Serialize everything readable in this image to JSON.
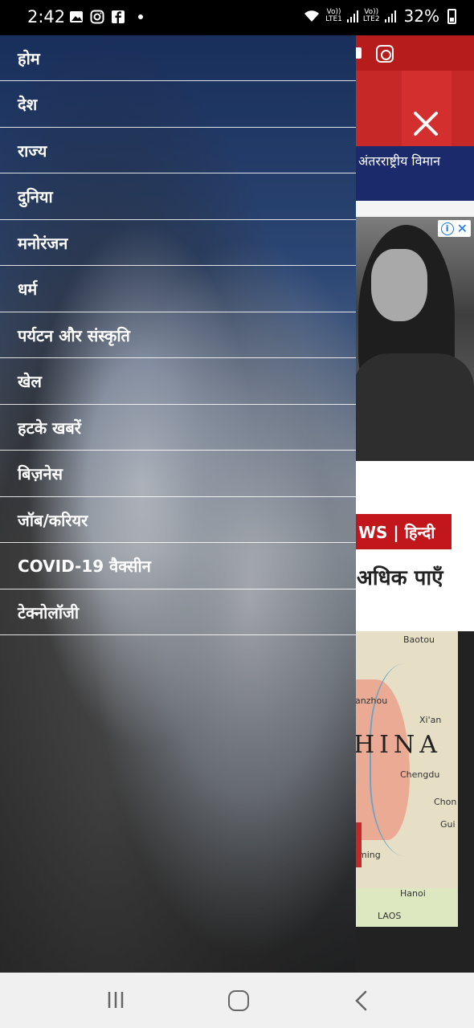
{
  "status_bar": {
    "time": "2:42",
    "network_1": "Vo))\nLTE1",
    "network_2": "Vo))\nLTE2",
    "battery": "32%"
  },
  "page_behind": {
    "ticker_text": "अंतरराष्ट्रीय विमान",
    "bbc_label": "WS | हिन्दी",
    "bbc_headline": "अधिक पाएँ",
    "map_labels": [
      "Baotou",
      "anzhou",
      "Xi'an",
      "HINA",
      "Chengdu",
      "Chon",
      "Gui",
      "ming",
      "Hanoi",
      "LAOS"
    ]
  },
  "drawer": {
    "items": [
      {
        "label": "होम"
      },
      {
        "label": "देश"
      },
      {
        "label": "राज्य"
      },
      {
        "label": "दुनिया"
      },
      {
        "label": "मनोरंजन"
      },
      {
        "label": "धर्म"
      },
      {
        "label": "पर्यटन और संस्कृति"
      },
      {
        "label": "खेल"
      },
      {
        "label": "हटके खबरें"
      },
      {
        "label": "बिज़नेस"
      },
      {
        "label": "जॉब/करियर"
      },
      {
        "label": "COVID-19 वैक्सीन"
      },
      {
        "label": "टेक्नोलॉजी"
      }
    ]
  },
  "colors": {
    "brand_red": "#c62828",
    "navy": "#1b2a6b",
    "ad_choices_blue": "#1a73e8"
  }
}
